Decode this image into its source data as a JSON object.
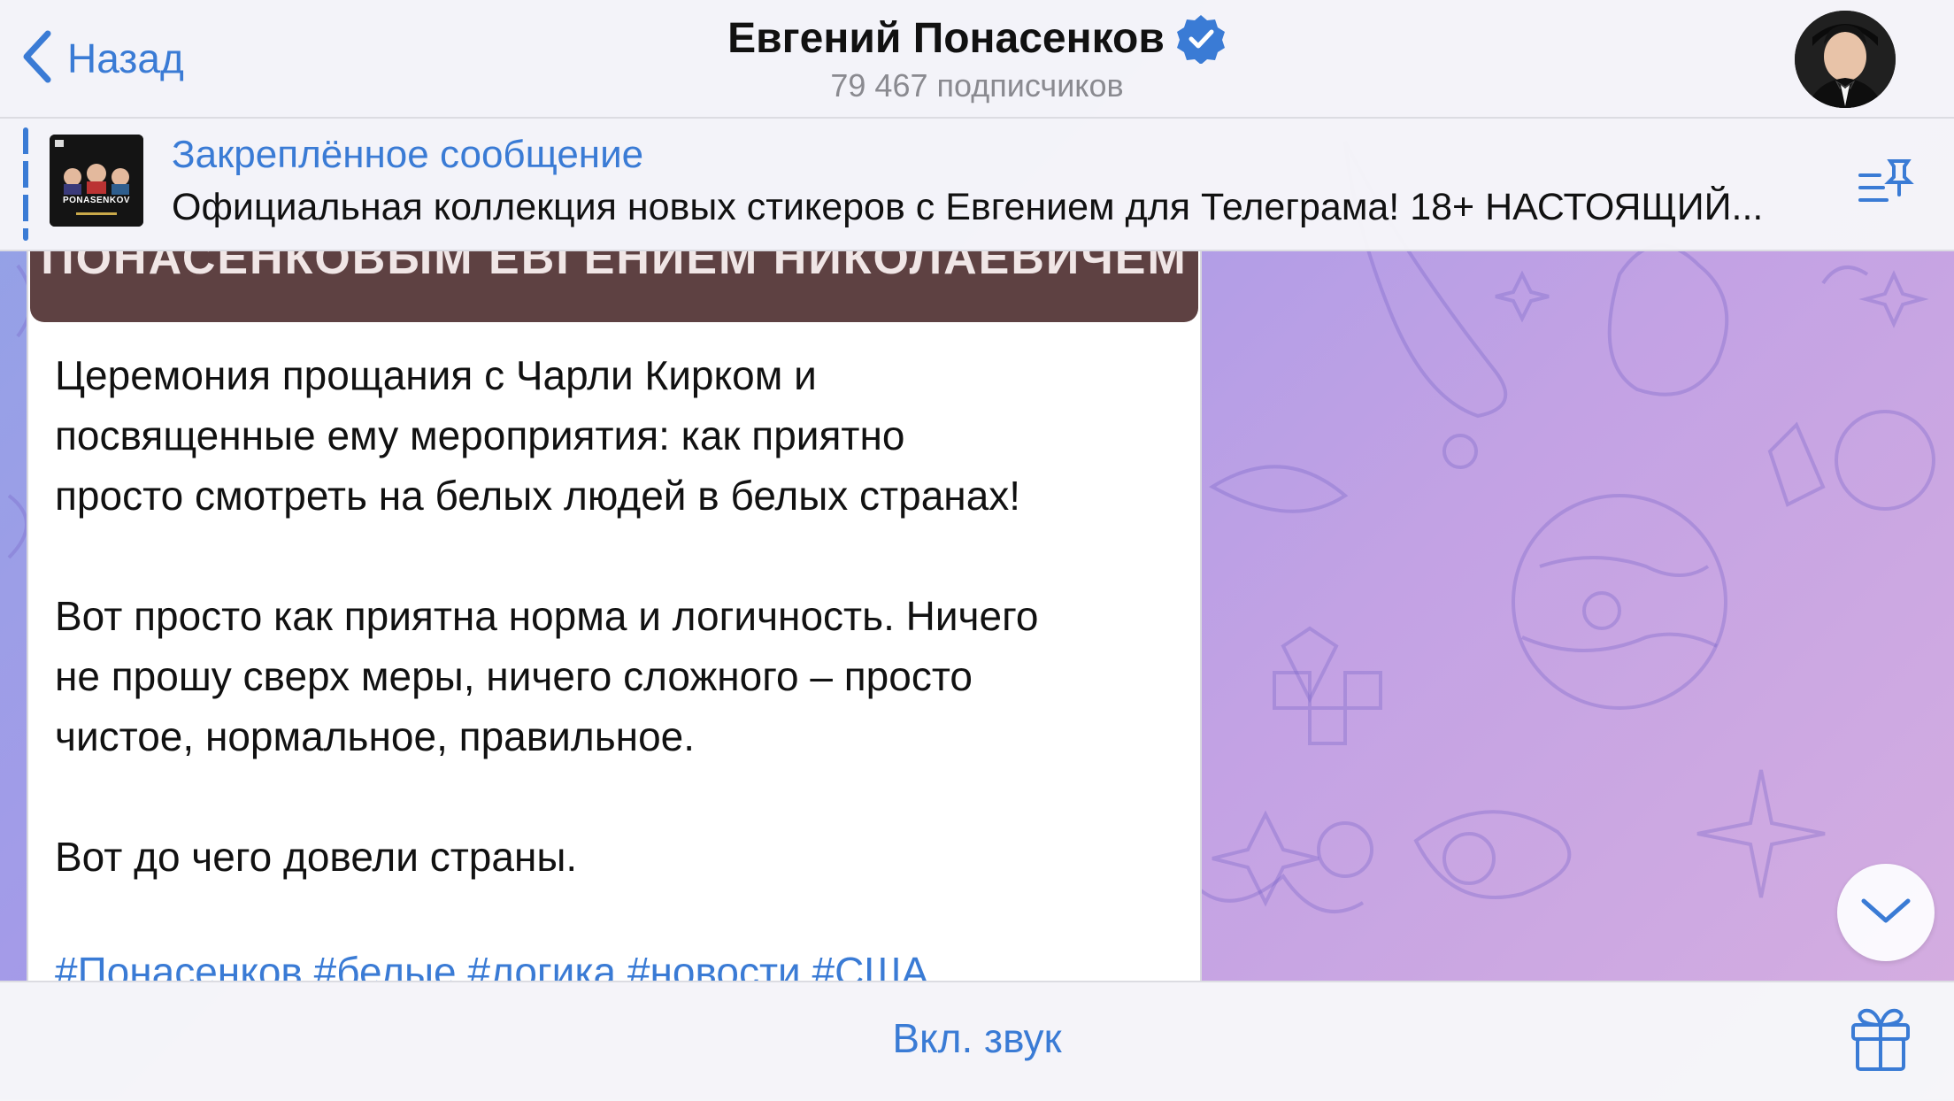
{
  "header": {
    "back_label": "Назад",
    "title": "Евгений Понасенков",
    "subtitle": "79 467 подписчиков",
    "verified_icon": "verified-badge-icon",
    "avatar_icon": "channel-avatar"
  },
  "pinned": {
    "title": "Закреплённое сообщение",
    "text": "Официальная коллекция новых стикеров с Евгением для Телеграма! 18+ НАСТОЯЩИЙ...",
    "thumb_label": "PONASENKOV",
    "list_icon": "pinned-list-icon"
  },
  "message": {
    "media_caption": "ПОНАСЕНКОВЫМ ЕВГЕНИЕМ НИКОЛАЕВИЧЕМ",
    "text": "Церемония прощания с Чарли Кирком и\nпосвященные ему мероприятия: как приятно\nпросто смотреть на белых людей в белых странах!\n\nВот просто как приятна норма и логичность. Ничего\nне прошу сверх меры, ничего сложного – просто\nчистое, нормальное, правильное.\n\nВот до чего довели страны.",
    "hashtags": "#Понасенков #белые #логика #новости #США"
  },
  "scroll_button_icon": "chevron-down-icon",
  "bottom_bar": {
    "unmute_label": "Вкл. звук",
    "gift_icon": "gift-icon"
  },
  "colors": {
    "accent": "#3a7bd5",
    "bar_background": "#f6f6f9",
    "media_strip": "#5e4142"
  }
}
